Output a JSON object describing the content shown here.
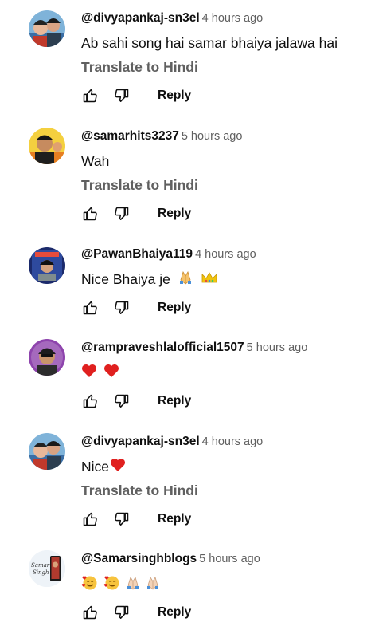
{
  "comments": [
    {
      "author": "@divyapankaj-sn3el",
      "time": "4 hours ago",
      "text": "Ab sahi song hai samar bhaiya jalawa hai",
      "translate": "Translate to Hindi",
      "reply": "Reply",
      "avatar": "avatar-couple"
    },
    {
      "author": "@samarhits3237",
      "time": "5 hours ago",
      "text": "Wah",
      "translate": "Translate to Hindi",
      "reply": "Reply",
      "avatar": "avatar-man-yellow"
    },
    {
      "author": "@PawanBhaiya119",
      "time": "4 hours ago",
      "text": "Nice Bhaiya je",
      "emojis": [
        "folded-hands",
        "crown"
      ],
      "reply": "Reply",
      "avatar": "avatar-poster-blue"
    },
    {
      "author": "@rampraveshlalofficial1507",
      "time": "5 hours ago",
      "text": "",
      "emojis": [
        "red-heart",
        "red-heart"
      ],
      "reply": "Reply",
      "avatar": "avatar-man-purple"
    },
    {
      "author": "@divyapankaj-sn3el",
      "time": "4 hours ago",
      "text": "Nice",
      "emojis": [
        "red-heart"
      ],
      "translate": "Translate to Hindi",
      "reply": "Reply",
      "avatar": "avatar-couple"
    },
    {
      "author": "@Samarsinghblogs",
      "time": "5 hours ago",
      "text": "",
      "emojis": [
        "smiling-face-with-hearts",
        "smiling-face-with-hearts",
        "folded-hands",
        "folded-hands"
      ],
      "reply": "Reply",
      "avatar": "avatar-logo",
      "avatar_text": "Samar Singh"
    }
  ],
  "colors": {
    "text": "#0f0f0f",
    "secondary": "#606060",
    "heart": "#e0201f"
  }
}
